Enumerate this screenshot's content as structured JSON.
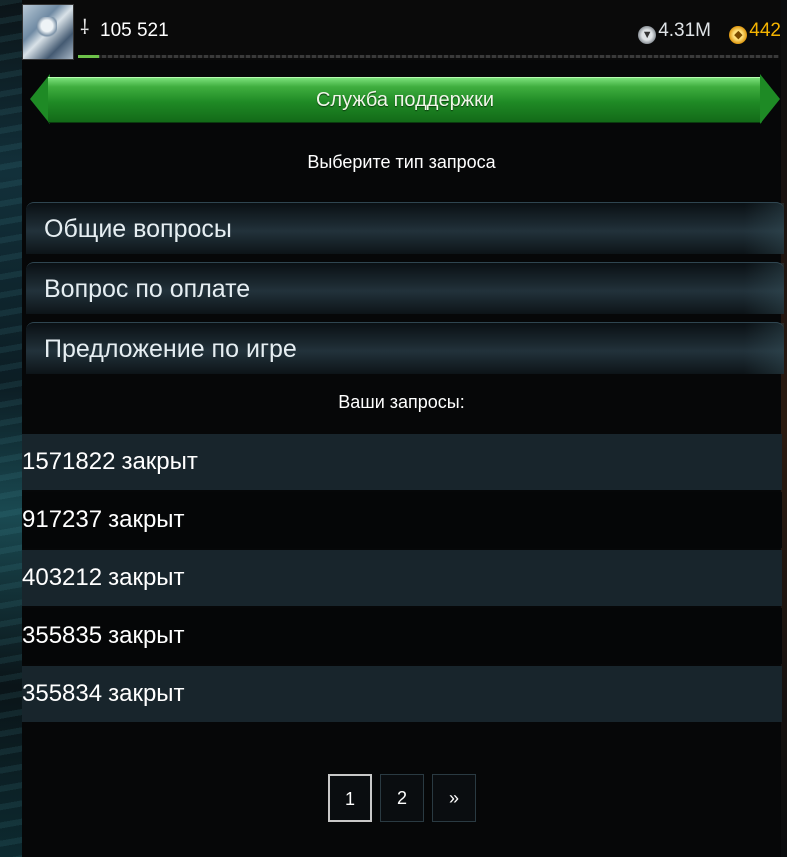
{
  "topbar": {
    "score": "105 521",
    "silver": "4.31M",
    "gold": "442",
    "exp_progress": 0.03,
    "icons": [
      "avatar",
      "dagger-icon",
      "silver-coin-icon",
      "gold-coin-icon"
    ]
  },
  "title": "Служба поддержки",
  "request_type_heading": "Выберите тип запроса",
  "request_types": [
    {
      "label": "Общие вопросы"
    },
    {
      "label": "Вопрос по оплате"
    },
    {
      "label": "Предложение по игре"
    }
  ],
  "my_requests_heading": "Ваши запросы:",
  "requests": [
    {
      "id": "1571822",
      "status": "закрыт"
    },
    {
      "id": "917237",
      "status": "закрыт"
    },
    {
      "id": "403212",
      "status": "закрыт"
    },
    {
      "id": "355835",
      "status": "закрыт"
    },
    {
      "id": "355834",
      "status": "закрыт"
    }
  ],
  "pagination": {
    "pages": [
      "1",
      "2"
    ],
    "current": "1",
    "next": "»"
  },
  "colors": {
    "banner_green": "#1f8a25",
    "banner_text": "#f0f7e8",
    "gold": "#f5b400",
    "row_alt": "#18252c",
    "background": "#060708"
  }
}
